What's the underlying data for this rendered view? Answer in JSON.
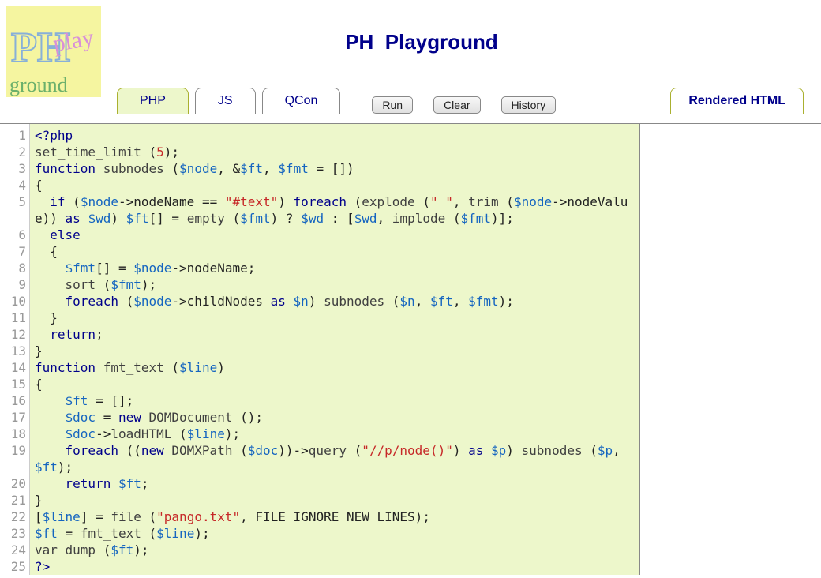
{
  "title": "PH_Playground",
  "tabs": {
    "php": "PHP",
    "js": "JS",
    "qcon": "QCon",
    "rendered": "Rendered HTML"
  },
  "buttons": {
    "run": "Run",
    "clear": "Clear",
    "history": "History"
  },
  "code_lines": [
    [
      {
        "t": "<?php",
        "c": "kw"
      }
    ],
    [
      {
        "t": "set_time_limit ",
        "c": "fn"
      },
      {
        "t": "(",
        "c": "op"
      },
      {
        "t": "5",
        "c": "str"
      },
      {
        "t": ");",
        "c": "op"
      }
    ],
    [
      {
        "t": "function ",
        "c": "kw"
      },
      {
        "t": "subnodes ",
        "c": "fn"
      },
      {
        "t": "(",
        "c": "op"
      },
      {
        "t": "$node",
        "c": "var"
      },
      {
        "t": ", &",
        "c": "op"
      },
      {
        "t": "$ft",
        "c": "var"
      },
      {
        "t": ", ",
        "c": "op"
      },
      {
        "t": "$fmt",
        "c": "var"
      },
      {
        "t": " = [])",
        "c": "op"
      }
    ],
    [
      {
        "t": "{",
        "c": "op"
      }
    ],
    [
      {
        "t": "  ",
        "c": "op"
      },
      {
        "t": "if ",
        "c": "kw"
      },
      {
        "t": "(",
        "c": "op"
      },
      {
        "t": "$node",
        "c": "var"
      },
      {
        "t": "->nodeName == ",
        "c": "op"
      },
      {
        "t": "\"#text\"",
        "c": "str"
      },
      {
        "t": ") ",
        "c": "op"
      },
      {
        "t": "foreach ",
        "c": "kw"
      },
      {
        "t": "(",
        "c": "op"
      },
      {
        "t": "explode ",
        "c": "fn"
      },
      {
        "t": "(",
        "c": "op"
      },
      {
        "t": "\" \"",
        "c": "str"
      },
      {
        "t": ", ",
        "c": "op"
      },
      {
        "t": "trim ",
        "c": "fn"
      },
      {
        "t": "(",
        "c": "op"
      },
      {
        "t": "$node",
        "c": "var"
      },
      {
        "t": "->nodeValue)) ",
        "c": "op"
      },
      {
        "t": "as ",
        "c": "kw"
      },
      {
        "t": "$wd",
        "c": "var"
      },
      {
        "t": ") ",
        "c": "op"
      },
      {
        "t": "$ft",
        "c": "var"
      },
      {
        "t": "[] = ",
        "c": "op"
      },
      {
        "t": "empty ",
        "c": "fn"
      },
      {
        "t": "(",
        "c": "op"
      },
      {
        "t": "$fmt",
        "c": "var"
      },
      {
        "t": ") ? ",
        "c": "op"
      },
      {
        "t": "$wd",
        "c": "var"
      },
      {
        "t": " : [",
        "c": "op"
      },
      {
        "t": "$wd",
        "c": "var"
      },
      {
        "t": ", ",
        "c": "op"
      },
      {
        "t": "implode ",
        "c": "fn"
      },
      {
        "t": "(",
        "c": "op"
      },
      {
        "t": "$fmt",
        "c": "var"
      },
      {
        "t": ")];",
        "c": "op"
      }
    ],
    [
      {
        "t": "  ",
        "c": "op"
      },
      {
        "t": "else",
        "c": "kw"
      }
    ],
    [
      {
        "t": "  {",
        "c": "op"
      }
    ],
    [
      {
        "t": "    ",
        "c": "op"
      },
      {
        "t": "$fmt",
        "c": "var"
      },
      {
        "t": "[] = ",
        "c": "op"
      },
      {
        "t": "$node",
        "c": "var"
      },
      {
        "t": "->nodeName;",
        "c": "op"
      }
    ],
    [
      {
        "t": "    ",
        "c": "op"
      },
      {
        "t": "sort ",
        "c": "fn"
      },
      {
        "t": "(",
        "c": "op"
      },
      {
        "t": "$fmt",
        "c": "var"
      },
      {
        "t": ");",
        "c": "op"
      }
    ],
    [
      {
        "t": "    ",
        "c": "op"
      },
      {
        "t": "foreach ",
        "c": "kw"
      },
      {
        "t": "(",
        "c": "op"
      },
      {
        "t": "$node",
        "c": "var"
      },
      {
        "t": "->childNodes ",
        "c": "op"
      },
      {
        "t": "as ",
        "c": "kw"
      },
      {
        "t": "$n",
        "c": "var"
      },
      {
        "t": ") ",
        "c": "op"
      },
      {
        "t": "subnodes ",
        "c": "fn"
      },
      {
        "t": "(",
        "c": "op"
      },
      {
        "t": "$n",
        "c": "var"
      },
      {
        "t": ", ",
        "c": "op"
      },
      {
        "t": "$ft",
        "c": "var"
      },
      {
        "t": ", ",
        "c": "op"
      },
      {
        "t": "$fmt",
        "c": "var"
      },
      {
        "t": ");",
        "c": "op"
      }
    ],
    [
      {
        "t": "  }",
        "c": "op"
      }
    ],
    [
      {
        "t": "  ",
        "c": "op"
      },
      {
        "t": "return",
        "c": "kw"
      },
      {
        "t": ";",
        "c": "op"
      }
    ],
    [
      {
        "t": "}",
        "c": "op"
      }
    ],
    [
      {
        "t": "function ",
        "c": "kw"
      },
      {
        "t": "fmt_text ",
        "c": "fn"
      },
      {
        "t": "(",
        "c": "op"
      },
      {
        "t": "$line",
        "c": "var"
      },
      {
        "t": ")",
        "c": "op"
      }
    ],
    [
      {
        "t": "{",
        "c": "op"
      }
    ],
    [
      {
        "t": "    ",
        "c": "op"
      },
      {
        "t": "$ft",
        "c": "var"
      },
      {
        "t": " = [];",
        "c": "op"
      }
    ],
    [
      {
        "t": "    ",
        "c": "op"
      },
      {
        "t": "$doc",
        "c": "var"
      },
      {
        "t": " = ",
        "c": "op"
      },
      {
        "t": "new ",
        "c": "kw"
      },
      {
        "t": "DOMDocument ",
        "c": "fn"
      },
      {
        "t": "();",
        "c": "op"
      }
    ],
    [
      {
        "t": "    ",
        "c": "op"
      },
      {
        "t": "$doc",
        "c": "var"
      },
      {
        "t": "->",
        "c": "op"
      },
      {
        "t": "loadHTML ",
        "c": "fn"
      },
      {
        "t": "(",
        "c": "op"
      },
      {
        "t": "$line",
        "c": "var"
      },
      {
        "t": ");",
        "c": "op"
      }
    ],
    [
      {
        "t": "    ",
        "c": "op"
      },
      {
        "t": "foreach ",
        "c": "kw"
      },
      {
        "t": "((",
        "c": "op"
      },
      {
        "t": "new ",
        "c": "kw"
      },
      {
        "t": "DOMXPath ",
        "c": "fn"
      },
      {
        "t": "(",
        "c": "op"
      },
      {
        "t": "$doc",
        "c": "var"
      },
      {
        "t": "))->",
        "c": "op"
      },
      {
        "t": "query ",
        "c": "fn"
      },
      {
        "t": "(",
        "c": "op"
      },
      {
        "t": "\"//p/node()\"",
        "c": "str"
      },
      {
        "t": ") ",
        "c": "op"
      },
      {
        "t": "as ",
        "c": "kw"
      },
      {
        "t": "$p",
        "c": "var"
      },
      {
        "t": ") ",
        "c": "op"
      },
      {
        "t": "subnodes ",
        "c": "fn"
      },
      {
        "t": "(",
        "c": "op"
      },
      {
        "t": "$p",
        "c": "var"
      },
      {
        "t": ", ",
        "c": "op"
      },
      {
        "t": "$ft",
        "c": "var"
      },
      {
        "t": ");",
        "c": "op"
      }
    ],
    [
      {
        "t": "    ",
        "c": "op"
      },
      {
        "t": "return ",
        "c": "kw"
      },
      {
        "t": "$ft",
        "c": "var"
      },
      {
        "t": ";",
        "c": "op"
      }
    ],
    [
      {
        "t": "}",
        "c": "op"
      }
    ],
    [
      {
        "t": "[",
        "c": "op"
      },
      {
        "t": "$line",
        "c": "var"
      },
      {
        "t": "] = ",
        "c": "op"
      },
      {
        "t": "file ",
        "c": "fn"
      },
      {
        "t": "(",
        "c": "op"
      },
      {
        "t": "\"pango.txt\"",
        "c": "str"
      },
      {
        "t": ", FILE_IGNORE_NEW_LINES);",
        "c": "op"
      }
    ],
    [
      {
        "t": "$ft",
        "c": "var"
      },
      {
        "t": " = ",
        "c": "op"
      },
      {
        "t": "fmt_text ",
        "c": "fn"
      },
      {
        "t": "(",
        "c": "op"
      },
      {
        "t": "$line",
        "c": "var"
      },
      {
        "t": ");",
        "c": "op"
      }
    ],
    [
      {
        "t": "var_dump ",
        "c": "fn"
      },
      {
        "t": "(",
        "c": "op"
      },
      {
        "t": "$ft",
        "c": "var"
      },
      {
        "t": ");",
        "c": "op"
      }
    ],
    [
      {
        "t": "?>",
        "c": "kw"
      }
    ]
  ],
  "line_numbers": [
    "1",
    "2",
    "3",
    "4",
    "5",
    "",
    "6",
    "7",
    "8",
    "9",
    "10",
    "11",
    "12",
    "13",
    "14",
    "15",
    "16",
    "17",
    "18",
    "19",
    "",
    "20",
    "21",
    "22",
    "23",
    "24",
    "25"
  ]
}
